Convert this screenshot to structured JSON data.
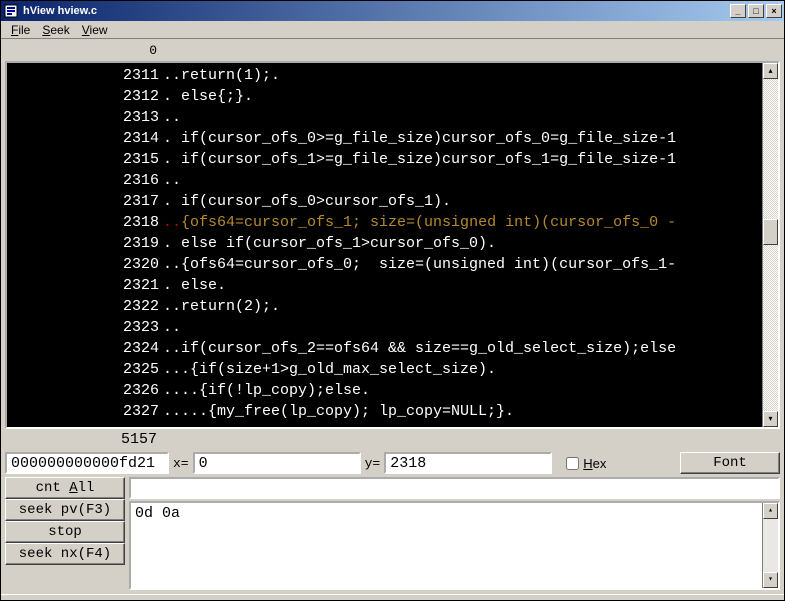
{
  "window": {
    "title": "hView hview.c"
  },
  "menu": {
    "file": "File",
    "seek": "Seek",
    "view": "View"
  },
  "ruler": "0",
  "total_lines": "5157",
  "lines": [
    {
      "n": "2311",
      "text": "..return(1);."
    },
    {
      "n": "2312",
      "text": ". else{;}."
    },
    {
      "n": "2313",
      "text": ".."
    },
    {
      "n": "2314",
      "text": ". if(cursor_ofs_0>=g_file_size)cursor_ofs_0=g_file_size-1"
    },
    {
      "n": "2315",
      "text": ". if(cursor_ofs_1>=g_file_size)cursor_ofs_1=g_file_size-1"
    },
    {
      "n": "2316",
      "text": ".."
    },
    {
      "n": "2317",
      "text": ". if(cursor_ofs_0>cursor_ofs_1)."
    },
    {
      "n": "2318",
      "pre": "..",
      "hl": "{ofs64=cursor_ofs_1; size=(unsigned int)(cursor_ofs_0 -"
    },
    {
      "n": "2319",
      "text": ". else if(cursor_ofs_1>cursor_ofs_0)."
    },
    {
      "n": "2320",
      "text": "..{ofs64=cursor_ofs_0;  size=(unsigned int)(cursor_ofs_1-"
    },
    {
      "n": "2321",
      "text": ". else."
    },
    {
      "n": "2322",
      "text": "..return(2);."
    },
    {
      "n": "2323",
      "text": ".."
    },
    {
      "n": "2324",
      "text": "..if(cursor_ofs_2==ofs64 && size==g_old_select_size);else"
    },
    {
      "n": "2325",
      "text": "...{if(size+1>g_old_max_select_size)."
    },
    {
      "n": "2326",
      "text": "....{if(!lp_copy);else."
    },
    {
      "n": "2327",
      "text": ".....{my_free(lp_copy); lp_copy=NULL;}."
    }
  ],
  "inputs": {
    "offset": "000000000000fd21",
    "x_label": "x=",
    "x": "0",
    "y_label": "y=",
    "y": "2318",
    "hex_label": "Hex",
    "font_label": "Font"
  },
  "buttons": {
    "cnt_all": "cnt All",
    "seek_pv": "seek pv(F3)",
    "stop": "stop",
    "seek_nx": "seek nx(F4)"
  },
  "search_value": "0d 0a"
}
